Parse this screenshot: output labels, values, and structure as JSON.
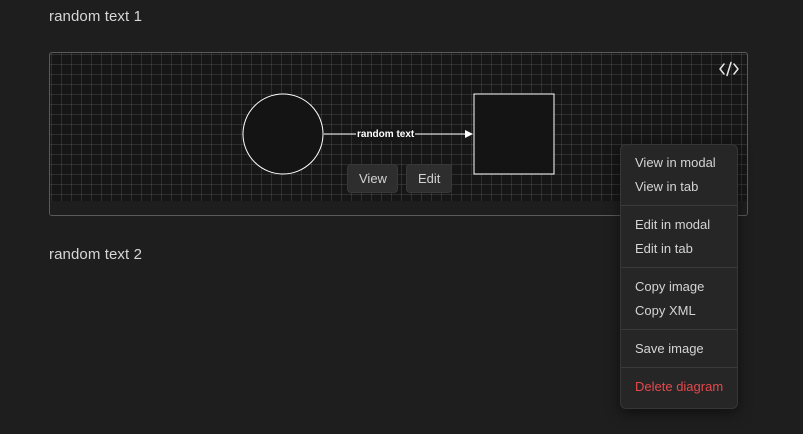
{
  "paragraphs": {
    "first": "random text 1",
    "second": "random text 2"
  },
  "diagram": {
    "code_icon": "code-icon",
    "edge_label": "random text",
    "view_label": "View",
    "edit_label": "Edit"
  },
  "context_menu": {
    "view_in_modal": "View in modal",
    "view_in_tab": "View in tab",
    "edit_in_modal": "Edit in modal",
    "edit_in_tab": "Edit in tab",
    "copy_image": "Copy image",
    "copy_xml": "Copy XML",
    "save_image": "Save image",
    "delete_diagram": "Delete diagram"
  },
  "colors": {
    "background": "#1e1e1e",
    "danger": "#e5484d"
  }
}
